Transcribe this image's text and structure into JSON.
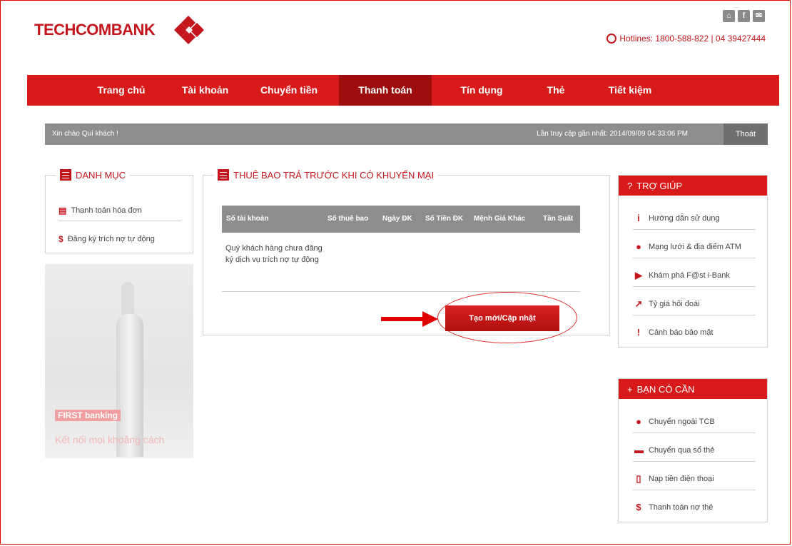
{
  "header": {
    "logo_text": "TECHCOMBANK",
    "hotline": "Hotlines: 1800-588-822 | 04 39427444",
    "icons": [
      "home-icon",
      "facebook-icon",
      "mail-icon"
    ]
  },
  "nav": {
    "items": [
      "Trang chủ",
      "Tài khoản",
      "Chuyển tiền",
      "Thanh toán",
      "Tín dụng",
      "Thẻ",
      "Tiết kiệm"
    ],
    "active": "Thanh toán"
  },
  "welcome": {
    "greeting": "Xin chào Quí khách !",
    "last_access": "Lần truy cập gần nhất: 2014/09/09 04:33:06 PM",
    "logout": "Thoát"
  },
  "category": {
    "title": "DANH MỤC",
    "items": [
      "Thanh toán hóa đơn",
      "Đăng ký trích nợ tự động"
    ]
  },
  "banner": {
    "brand": "FIRST banking",
    "tagline": "Kết nối mọi khoảng cách"
  },
  "main": {
    "title": "THUÊ BAO TRẢ TRƯỚC KHI CÓ KHUYẾN MẠI",
    "columns": [
      "Số tài khoản",
      "Số thuê bao",
      "Ngày ĐK",
      "Số Tiền ĐK",
      "Mệnh Giá Khác",
      "Tần Suất"
    ],
    "empty_message": "Quý khách hàng chưa đăng ký dịch vụ trích nợ tự động",
    "create_button": "Tạo mới/Cập nhật"
  },
  "help": {
    "title": "TRỢ GIÚP",
    "items": [
      "Hướng dẫn sử dụng",
      "Mạng lưới & địa điểm ATM",
      "Khám phá F@st i-Bank",
      "Tỷ giá hối đoái",
      "Cảnh báo bảo mật"
    ]
  },
  "need": {
    "title": "BẠN CÓ CẦN",
    "items": [
      "Chuyển ngoài TCB",
      "Chuyển qua sổ thẻ",
      "Nạp tiền điện thoại",
      "Thanh toán nợ thẻ"
    ]
  },
  "colors": {
    "brand_red": "#d81a1a",
    "dark_red": "#9e0d0d",
    "gray_bar": "#8d8d8d"
  }
}
